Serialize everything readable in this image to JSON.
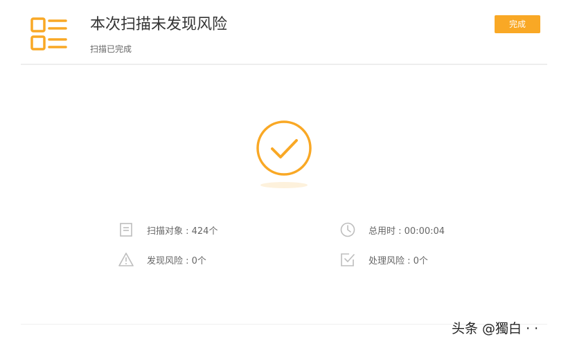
{
  "header": {
    "title": "本次扫描未发现风险",
    "subtitle": "扫描已完成",
    "done_label": "完成",
    "icon": "list-icon"
  },
  "status": {
    "icon": "check-circle-icon"
  },
  "stats": {
    "scan_objects": {
      "label": "扫描对象 : 424个",
      "icon": "document-icon"
    },
    "total_time": {
      "label": "总用时 : 00:00:04",
      "icon": "clock-icon"
    },
    "found_risk": {
      "label": "发现风险 : 0个",
      "icon": "warning-icon"
    },
    "handled_risk": {
      "label": "处理风险 : 0个",
      "icon": "checkbox-icon"
    }
  },
  "watermark": {
    "text": "头条 @獨白 · ·"
  },
  "colors": {
    "accent": "#f9a825",
    "icon_gray": "#bdbdbd",
    "text_dark": "#333333",
    "text_muted": "#666666"
  }
}
